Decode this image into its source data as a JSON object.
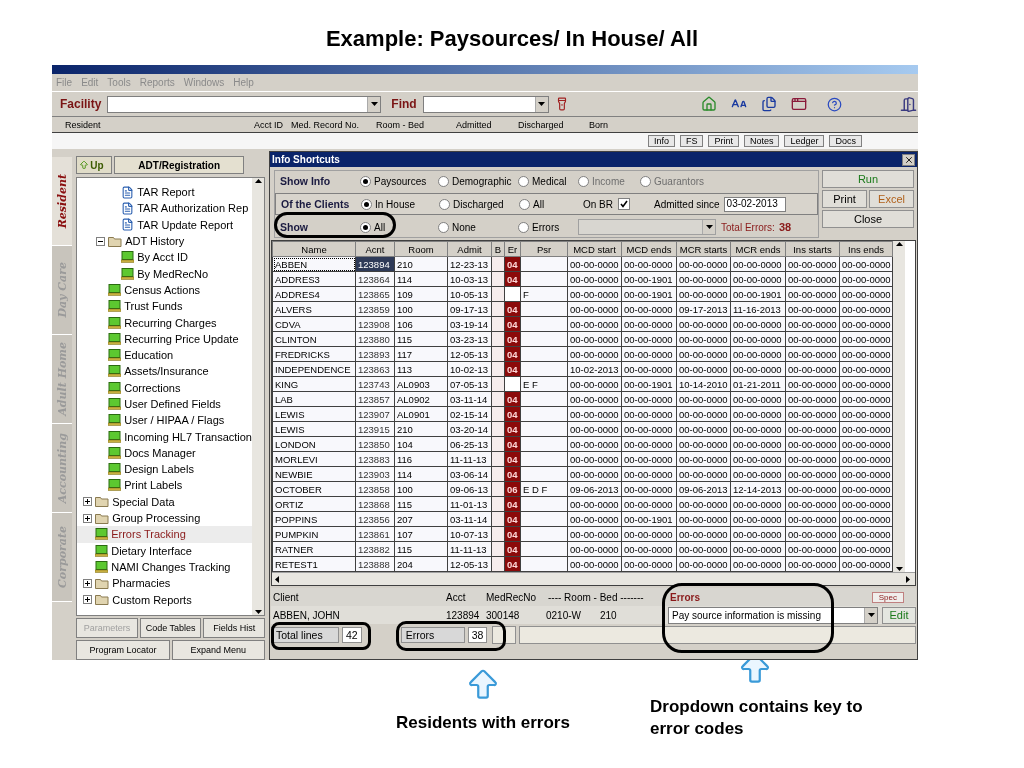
{
  "slide_title": "Example: Paysources/ In House/ All",
  "menu": [
    "File",
    "Edit",
    "Tools",
    "Reports",
    "Windows",
    "Help"
  ],
  "facility_bar": {
    "facility_label": "Facility",
    "find_label": "Find"
  },
  "resident_header": [
    "Resident",
    "Acct ID",
    "Med. Record No.",
    "Room - Bed",
    "Admitted",
    "Discharged",
    "Born"
  ],
  "resident_buttons": [
    "Info",
    "FS",
    "Print",
    "Notes",
    "Ledger",
    "Docs"
  ],
  "side_tabs": [
    {
      "label": "Resident",
      "selected": true
    },
    {
      "label": "Day Care",
      "selected": false
    },
    {
      "label": "Adult Home",
      "selected": false
    },
    {
      "label": "Accounting",
      "selected": false
    },
    {
      "label": "Corporate",
      "selected": false
    }
  ],
  "tree_panel": {
    "up_button": "Up",
    "title_button": "ADT/Registration",
    "items": [
      {
        "children": [
          {
            "children": [
              {
                "label": "TAR Report",
                "kind": "document",
                "selected": false
              },
              {
                "label": "TAR Authorization Rep",
                "kind": "document",
                "selected": false
              },
              {
                "label": "TAR Update Report",
                "kind": "document",
                "selected": false
              }
            ]
          },
          {
            "label": "ADT History",
            "kind": "folder",
            "expanded": true,
            "selected": false,
            "children": [
              {
                "label": "By Acct ID",
                "kind": "program",
                "selected": false
              },
              {
                "label": "By MedRecNo",
                "kind": "program",
                "selected": false
              }
            ]
          },
          {
            "label": "Census Actions",
            "kind": "program",
            "selected": false
          },
          {
            "label": "Trust Funds",
            "kind": "program",
            "selected": false
          },
          {
            "label": "Recurring Charges",
            "kind": "program",
            "selected": false
          },
          {
            "label": "Recurring Price Update",
            "kind": "program",
            "selected": false
          },
          {
            "label": "Education",
            "kind": "program",
            "selected": false
          },
          {
            "label": "Assets/Insurance",
            "kind": "program",
            "selected": false
          },
          {
            "label": "Corrections",
            "kind": "program",
            "selected": false
          },
          {
            "label": "User Defined Fields",
            "kind": "program",
            "selected": false
          },
          {
            "label": "User / HIPAA / Flags",
            "kind": "program",
            "selected": false
          },
          {
            "label": "Incoming HL7 Transaction",
            "kind": "program",
            "selected": false
          },
          {
            "label": "Docs Manager",
            "kind": "program",
            "selected": false
          },
          {
            "label": "Design Labels",
            "kind": "program",
            "selected": false
          },
          {
            "label": "Print Labels",
            "kind": "program",
            "selected": false
          }
        ]
      },
      {
        "label": "Special Data",
        "kind": "folder",
        "expanded": false,
        "selected": false
      },
      {
        "label": "Group Processing",
        "kind": "folder",
        "expanded": false,
        "selected": false
      },
      {
        "label": "Errors Tracking",
        "kind": "program",
        "selected": true
      },
      {
        "label": "Dietary Interface",
        "kind": "program",
        "selected": false
      },
      {
        "label": "NAMI Changes Tracking",
        "kind": "program",
        "selected": false
      },
      {
        "label": "Pharmacies",
        "kind": "folder",
        "expanded": false,
        "selected": false
      },
      {
        "label": "Custom Reports",
        "kind": "folder",
        "expanded": false,
        "selected": false
      }
    ],
    "button_rows": [
      [
        {
          "label": "Parameters",
          "disabled": true
        },
        {
          "label": "Code Tables",
          "disabled": false
        },
        {
          "label": "Fields Hist",
          "disabled": false
        }
      ],
      [
        {
          "label": "Program Locator",
          "disabled": false
        },
        {
          "label": "Expand Menu",
          "disabled": false
        }
      ]
    ]
  },
  "dialog": {
    "title": "Info Shortcuts",
    "option_rows": [
      {
        "label": "Show Info",
        "options": [
          {
            "label": "Paysources",
            "selected": true,
            "disabled": false
          },
          {
            "label": "Demographic",
            "selected": false,
            "disabled": false
          },
          {
            "label": "Medical",
            "selected": false,
            "disabled": false
          },
          {
            "label": "Income",
            "selected": false,
            "disabled": true
          },
          {
            "label": "Guarantors",
            "selected": false,
            "disabled": true
          }
        ]
      },
      {
        "label": "Of the Clients",
        "options": [
          {
            "label": "In House",
            "selected": true,
            "disabled": false
          },
          {
            "label": "Discharged",
            "selected": false,
            "disabled": false
          },
          {
            "label": "All",
            "selected": false,
            "disabled": false
          }
        ]
      },
      {
        "label": "Show",
        "options": [
          {
            "label": "All",
            "selected": true,
            "disabled": false
          },
          {
            "label": "None",
            "selected": false,
            "disabled": false
          },
          {
            "label": "Errors",
            "selected": false,
            "disabled": false
          }
        ]
      }
    ],
    "on_br": {
      "label": "On BR",
      "checked": true
    },
    "admitted_since": {
      "label": "Admitted since",
      "value": "03-02-2013"
    },
    "error_filter": {
      "disabled": true
    },
    "total_errors": {
      "label": "Total Errors:",
      "value": "38"
    },
    "buttons": [
      {
        "label": "Run",
        "kind": "run"
      },
      {
        "label": "Print",
        "kind": "plain"
      },
      {
        "label": "Excel",
        "kind": "export"
      },
      {
        "label": "Close",
        "kind": "plain"
      }
    ]
  },
  "table": {
    "columns": [
      "Name",
      "Acnt",
      "Room",
      "Admit",
      "B",
      "Er",
      "Psr",
      "MCD start",
      "MCD ends",
      "MCR starts",
      "MCR ends",
      "Ins starts",
      "Ins ends"
    ],
    "rows": [
      {
        "selected": true,
        "name": "ABBEN",
        "acnt": "123894",
        "room": "210",
        "admit": "12-23-13",
        "er": "04",
        "dates": [
          "00-00-0000",
          "00-00-0000",
          "00-00-0000",
          "00-00-0000",
          "00-00-0000",
          "00-00-0000"
        ]
      },
      {
        "selected": false,
        "name": "ADDRES3",
        "acnt": "123864",
        "room": "114",
        "admit": "10-03-13",
        "er": "04",
        "dates": [
          "00-00-0000",
          "00-00-1901",
          "00-00-0000",
          "00-00-0000",
          "00-00-0000",
          "00-00-0000"
        ]
      },
      {
        "selected": false,
        "name": "ADDRES4",
        "acnt": "123865",
        "room": "109",
        "admit": "10-05-13",
        "psr": "F",
        "dates": [
          "00-00-0000",
          "00-00-1901",
          "00-00-0000",
          "00-00-1901",
          "00-00-0000",
          "00-00-0000"
        ]
      },
      {
        "selected": false,
        "name": "ALVERS",
        "acnt": "123859",
        "room": "100",
        "admit": "09-17-13",
        "er": "04",
        "dates": [
          "00-00-0000",
          "00-00-0000",
          "09-17-2013",
          "11-16-2013",
          "00-00-0000",
          "00-00-0000"
        ]
      },
      {
        "selected": false,
        "name": "CDVA",
        "acnt": "123908",
        "room": "106",
        "admit": "03-19-14",
        "er": "04",
        "dates": [
          "00-00-0000",
          "00-00-0000",
          "00-00-0000",
          "00-00-0000",
          "00-00-0000",
          "00-00-0000"
        ]
      },
      {
        "selected": false,
        "name": "CLINTON",
        "acnt": "123880",
        "room": "115",
        "admit": "03-23-13",
        "er": "04",
        "dates": [
          "00-00-0000",
          "00-00-0000",
          "00-00-0000",
          "00-00-0000",
          "00-00-0000",
          "00-00-0000"
        ]
      },
      {
        "selected": false,
        "name": "FREDRICKS",
        "acnt": "123893",
        "room": "117",
        "admit": "12-05-13",
        "er": "04",
        "dates": [
          "00-00-0000",
          "00-00-0000",
          "00-00-0000",
          "00-00-0000",
          "00-00-0000",
          "00-00-0000"
        ]
      },
      {
        "selected": false,
        "name": "INDEPENDENCE",
        "acnt": "123863",
        "room": "113",
        "admit": "10-02-13",
        "er": "04",
        "dates": [
          "10-02-2013",
          "00-00-0000",
          "00-00-0000",
          "00-00-0000",
          "00-00-0000",
          "00-00-0000"
        ]
      },
      {
        "selected": false,
        "name": "KING",
        "acnt": "123743",
        "room": "AL0903",
        "admit": "07-05-13",
        "psr": "E F",
        "dates": [
          "00-00-0000",
          "00-00-1901",
          "10-14-2010",
          "01-21-2011",
          "00-00-0000",
          "00-00-0000"
        ]
      },
      {
        "selected": false,
        "name": "LAB",
        "acnt": "123857",
        "room": "AL0902",
        "admit": "03-11-14",
        "er": "04",
        "dates": [
          "00-00-0000",
          "00-00-0000",
          "00-00-0000",
          "00-00-0000",
          "00-00-0000",
          "00-00-0000"
        ]
      },
      {
        "selected": false,
        "name": "LEWIS",
        "acnt": "123907",
        "room": "AL0901",
        "admit": "02-15-14",
        "er": "04",
        "dates": [
          "00-00-0000",
          "00-00-0000",
          "00-00-0000",
          "00-00-0000",
          "00-00-0000",
          "00-00-0000"
        ]
      },
      {
        "selected": false,
        "name": "LEWIS",
        "acnt": "123915",
        "room": "210",
        "admit": "03-20-14",
        "er": "04",
        "dates": [
          "00-00-0000",
          "00-00-0000",
          "00-00-0000",
          "00-00-0000",
          "00-00-0000",
          "00-00-0000"
        ]
      },
      {
        "selected": false,
        "name": "LONDON",
        "acnt": "123850",
        "room": "104",
        "admit": "06-25-13",
        "er": "04",
        "dates": [
          "00-00-0000",
          "00-00-0000",
          "00-00-0000",
          "00-00-0000",
          "00-00-0000",
          "00-00-0000"
        ]
      },
      {
        "selected": false,
        "name": "MORLEVI",
        "acnt": "123883",
        "room": "116",
        "admit": "11-11-13",
        "er": "04",
        "dates": [
          "00-00-0000",
          "00-00-0000",
          "00-00-0000",
          "00-00-0000",
          "00-00-0000",
          "00-00-0000"
        ]
      },
      {
        "selected": false,
        "name": "NEWBIE",
        "acnt": "123903",
        "room": "114",
        "admit": "03-06-14",
        "er": "04",
        "dates": [
          "00-00-0000",
          "00-00-0000",
          "00-00-0000",
          "00-00-0000",
          "00-00-0000",
          "00-00-0000"
        ]
      },
      {
        "selected": false,
        "name": "OCTOBER",
        "acnt": "123858",
        "room": "100",
        "admit": "09-06-13",
        "er": "06",
        "psr": "E D F",
        "dates": [
          "09-06-2013",
          "00-00-0000",
          "09-06-2013",
          "12-14-2013",
          "00-00-0000",
          "00-00-0000"
        ]
      },
      {
        "selected": false,
        "name": "ORTIZ",
        "acnt": "123868",
        "room": "115",
        "admit": "11-01-13",
        "er": "04",
        "dates": [
          "00-00-0000",
          "00-00-0000",
          "00-00-0000",
          "00-00-0000",
          "00-00-0000",
          "00-00-0000"
        ]
      },
      {
        "selected": false,
        "name": "POPPINS",
        "acnt": "123856",
        "room": "207",
        "admit": "03-11-14",
        "er": "04",
        "dates": [
          "00-00-0000",
          "00-00-1901",
          "00-00-0000",
          "00-00-0000",
          "00-00-0000",
          "00-00-0000"
        ]
      },
      {
        "selected": false,
        "name": "PUMPKIN",
        "acnt": "123861",
        "room": "107",
        "admit": "10-07-13",
        "er": "04",
        "dates": [
          "00-00-0000",
          "00-00-0000",
          "00-00-0000",
          "00-00-0000",
          "00-00-0000",
          "00-00-0000"
        ]
      },
      {
        "selected": false,
        "name": "RATNER",
        "acnt": "123882",
        "room": "115",
        "admit": "11-11-13",
        "er": "04",
        "dates": [
          "00-00-0000",
          "00-00-0000",
          "00-00-0000",
          "00-00-0000",
          "00-00-0000",
          "00-00-0000"
        ]
      },
      {
        "selected": false,
        "name": "RETEST1",
        "acnt": "123888",
        "room": "204",
        "admit": "12-05-13",
        "er": "04",
        "dates": [
          "00-00-0000",
          "00-00-0000",
          "00-00-0000",
          "00-00-0000",
          "00-00-0000",
          "00-00-0000"
        ]
      }
    ]
  },
  "client_panel": {
    "headers": [
      "Client",
      "Acct",
      "MedRecNo",
      "---- Room - Bed -------"
    ],
    "errors_label": "Errors",
    "spec_button": "Spec",
    "client": "ABBEN, JOHN",
    "acct": "123894",
    "med_rec_no": "300148",
    "room": "0210-W",
    "bed": "210",
    "error_select": "Pay source information is missing",
    "edit_button": "Edit"
  },
  "status": [
    {
      "label": "Total lines",
      "value": "42"
    },
    {
      "label": "Errors",
      "value": "38"
    }
  ],
  "annotations": [
    "Residents with errors",
    "Dropdown contains key to error codes"
  ]
}
